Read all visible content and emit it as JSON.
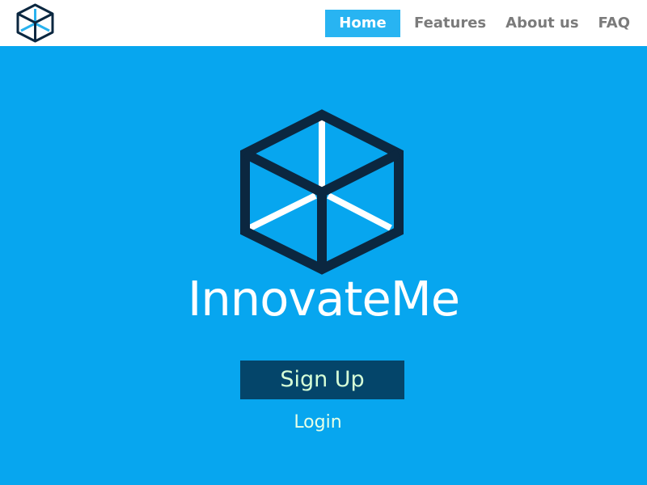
{
  "header": {
    "logo_icon": "cube-logo-icon",
    "nav": [
      {
        "label": "Home",
        "active": true
      },
      {
        "label": "Features",
        "active": false
      },
      {
        "label": "About us",
        "active": false
      },
      {
        "label": "FAQ",
        "active": false
      }
    ]
  },
  "hero": {
    "logo_icon": "cube-logo-icon",
    "brand_name": "InnovateMe",
    "signup_label": "Sign Up",
    "login_label": "Login"
  },
  "colors": {
    "background": "#07a6ef",
    "header_background": "#ffffff",
    "nav_active_background": "#28b4f2",
    "nav_text": "#7b7b7b",
    "cube_outline": "#0b2740",
    "cube_accent": "#29b2ee",
    "signup_background": "#04456a",
    "signup_text": "#d6ffd7"
  }
}
